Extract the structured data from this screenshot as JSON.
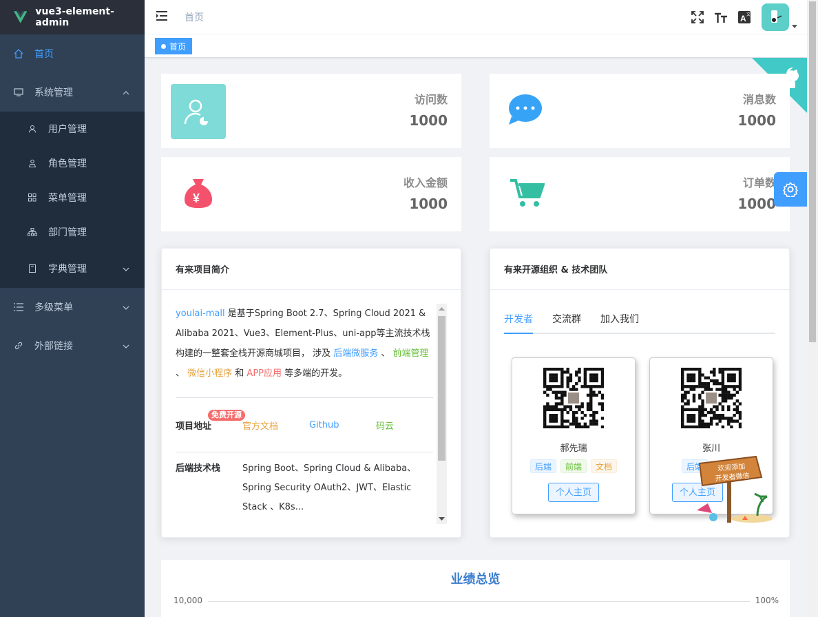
{
  "app": {
    "title": "vue3-element-admin"
  },
  "sidebar": {
    "items": [
      {
        "label": "首页",
        "icon": "home-icon",
        "active": true
      },
      {
        "label": "系统管理",
        "icon": "monitor-icon",
        "expanded": true,
        "children": [
          {
            "label": "用户管理",
            "icon": "user-icon"
          },
          {
            "label": "角色管理",
            "icon": "role-icon"
          },
          {
            "label": "菜单管理",
            "icon": "menu-grid-icon"
          },
          {
            "label": "部门管理",
            "icon": "tree-icon"
          },
          {
            "label": "字典管理",
            "icon": "book-icon"
          }
        ]
      },
      {
        "label": "多级菜单",
        "icon": "list-icon"
      },
      {
        "label": "外部链接",
        "icon": "link-icon"
      }
    ]
  },
  "navbar": {
    "breadcrumb": "首页"
  },
  "tagsview": {
    "active_tag": "首页"
  },
  "stats": [
    {
      "label": "访问数",
      "value": "1000",
      "icon": "visitor-icon"
    },
    {
      "label": "消息数",
      "value": "1000",
      "icon": "message-icon"
    },
    {
      "label": "收入金额",
      "value": "1000",
      "icon": "money-bag-icon"
    },
    {
      "label": "订单数",
      "value": "1000",
      "icon": "cart-icon"
    }
  ],
  "project": {
    "title": "有来项目简介",
    "intro": {
      "link1": "youlai-mall",
      "text1": " 是基于Spring Boot 2.7、Spring Cloud 2021 & Alibaba 2021、Vue3、Element-Plus、uni-app等主流技术栈构建的一整套全栈开源商城项目， 涉及 ",
      "link2": "后端微服务",
      "text2": " 、 ",
      "link3": "前端管理",
      "text3": " 、 ",
      "link4": "微信小程序",
      "text4": " 和 ",
      "link5": "APP应用",
      "text5": " 等多端的开发。"
    },
    "address_label": "项目地址",
    "badge": "免费开源",
    "links": [
      "官方文档",
      "Github",
      "码云"
    ],
    "stack_label": "后端技术栈",
    "stack_text": "Spring Boot、Spring Cloud & Alibaba、Spring Security OAuth2、JWT、Elastic Stack 、K8s..."
  },
  "team": {
    "title": "有来开源组织 & 技术团队",
    "tabs": [
      "开发者",
      "交流群",
      "加入我们"
    ],
    "members": [
      {
        "name": "郝先瑞",
        "tags": [
          "后端",
          "前端",
          "文档"
        ],
        "button": "个人主页"
      },
      {
        "name": "张川",
        "tags": [
          "后端"
        ],
        "button": "个人主页"
      }
    ],
    "sticker": "欢迎添加\n开发者微信"
  },
  "performance": {
    "title": "业绩总览",
    "y_left_top": "10,000",
    "y_right_top": "100%"
  },
  "colors": {
    "accent": "#409eff",
    "sidebar_bg": "#304156",
    "logo_bg": "#2b2f3a",
    "teal": "#40c9c6"
  }
}
